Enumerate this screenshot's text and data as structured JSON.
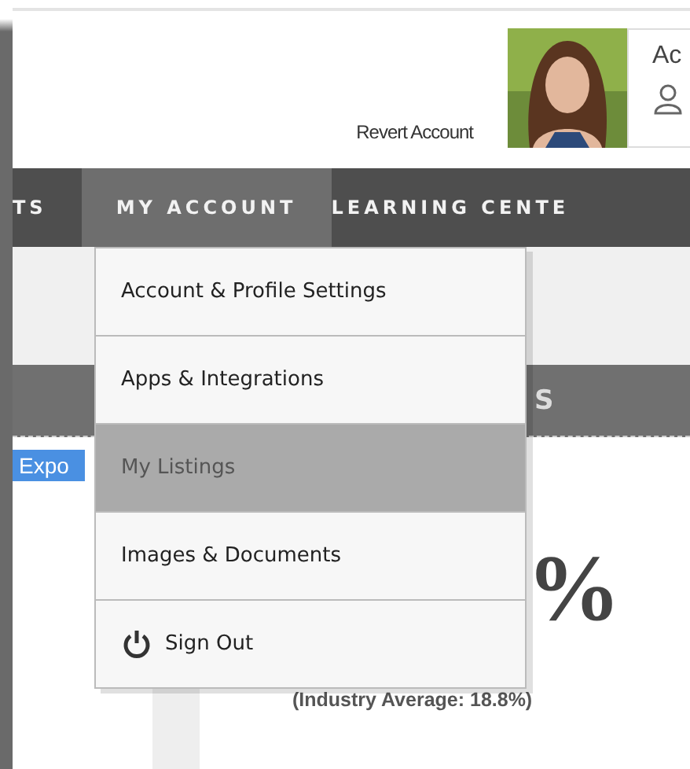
{
  "header": {
    "revert_link": "Revert Account",
    "account_card": {
      "label": "Ac"
    }
  },
  "nav": {
    "tabs": [
      {
        "label": "TS",
        "selected": false
      },
      {
        "label": "MY ACCOUNT",
        "selected": true
      },
      {
        "label": "LEARNING CENTE",
        "selected": false
      }
    ]
  },
  "section_bar": {
    "title": "S"
  },
  "export_button": "Expo",
  "stat": {
    "value": "%",
    "caption": "(Industry Average: 18.8%)"
  },
  "dropdown": {
    "items": [
      {
        "label": "Account & Profile Settings",
        "selected": false,
        "kind": "text"
      },
      {
        "label": "Apps & Integrations",
        "selected": false,
        "kind": "text"
      },
      {
        "label": "My Listings",
        "selected": true,
        "kind": "text"
      },
      {
        "label": "Images & Documents",
        "selected": false,
        "kind": "text"
      },
      {
        "label": "Sign Out",
        "selected": false,
        "kind": "power"
      }
    ]
  }
}
